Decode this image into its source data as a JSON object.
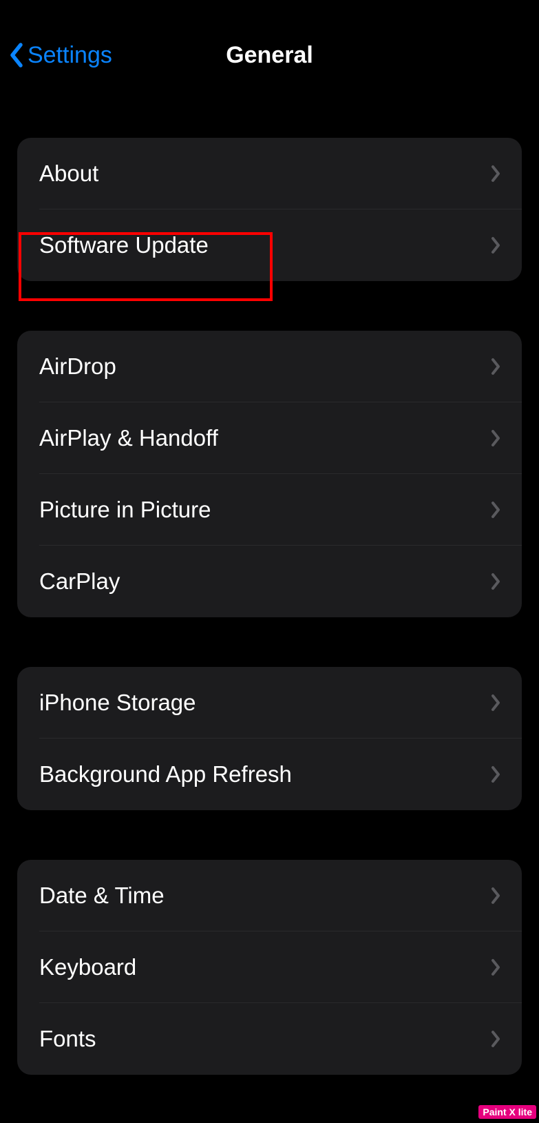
{
  "nav": {
    "back_label": "Settings",
    "title": "General"
  },
  "groups": [
    {
      "rows": [
        {
          "label": "About",
          "name": "row-about"
        },
        {
          "label": "Software Update",
          "name": "row-software-update"
        }
      ]
    },
    {
      "rows": [
        {
          "label": "AirDrop",
          "name": "row-airdrop"
        },
        {
          "label": "AirPlay & Handoff",
          "name": "row-airplay-handoff"
        },
        {
          "label": "Picture in Picture",
          "name": "row-picture-in-picture"
        },
        {
          "label": "CarPlay",
          "name": "row-carplay"
        }
      ]
    },
    {
      "rows": [
        {
          "label": "iPhone Storage",
          "name": "row-iphone-storage"
        },
        {
          "label": "Background App Refresh",
          "name": "row-background-app-refresh"
        }
      ]
    },
    {
      "rows": [
        {
          "label": "Date & Time",
          "name": "row-date-time"
        },
        {
          "label": "Keyboard",
          "name": "row-keyboard"
        },
        {
          "label": "Fonts",
          "name": "row-fonts"
        }
      ]
    }
  ],
  "highlight": {
    "target": "row-software-update",
    "color": "#ff0000"
  },
  "watermark": "Paint X lite",
  "colors": {
    "background": "#000000",
    "cell_background": "#1c1c1e",
    "text": "#ffffff",
    "accent": "#0a84ff",
    "chevron": "#5a5a5e",
    "separator": "#2a2a2c"
  }
}
